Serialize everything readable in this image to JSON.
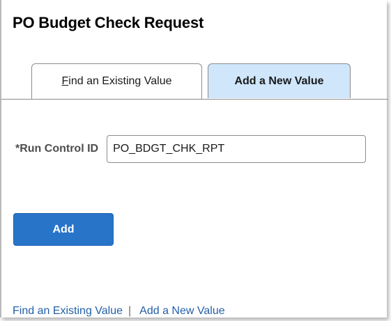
{
  "page": {
    "title": "PO Budget Check Request"
  },
  "tabs": [
    {
      "label_prefix": "F",
      "label_rest": "ind an Existing Value",
      "active": false
    },
    {
      "label": "Add a New Value",
      "active": true
    }
  ],
  "form": {
    "run_control_label": "*Run Control ID",
    "run_control_value": "PO_BDGT_CHK_RPT"
  },
  "actions": {
    "add_label": "Add"
  },
  "footer_links": {
    "find_existing": "Find an Existing Value",
    "separator": "|",
    "add_new": "Add a New Value"
  },
  "colors": {
    "accent": "#2874c9",
    "active_tab": "#cfe6fb",
    "link": "#2460a8"
  }
}
